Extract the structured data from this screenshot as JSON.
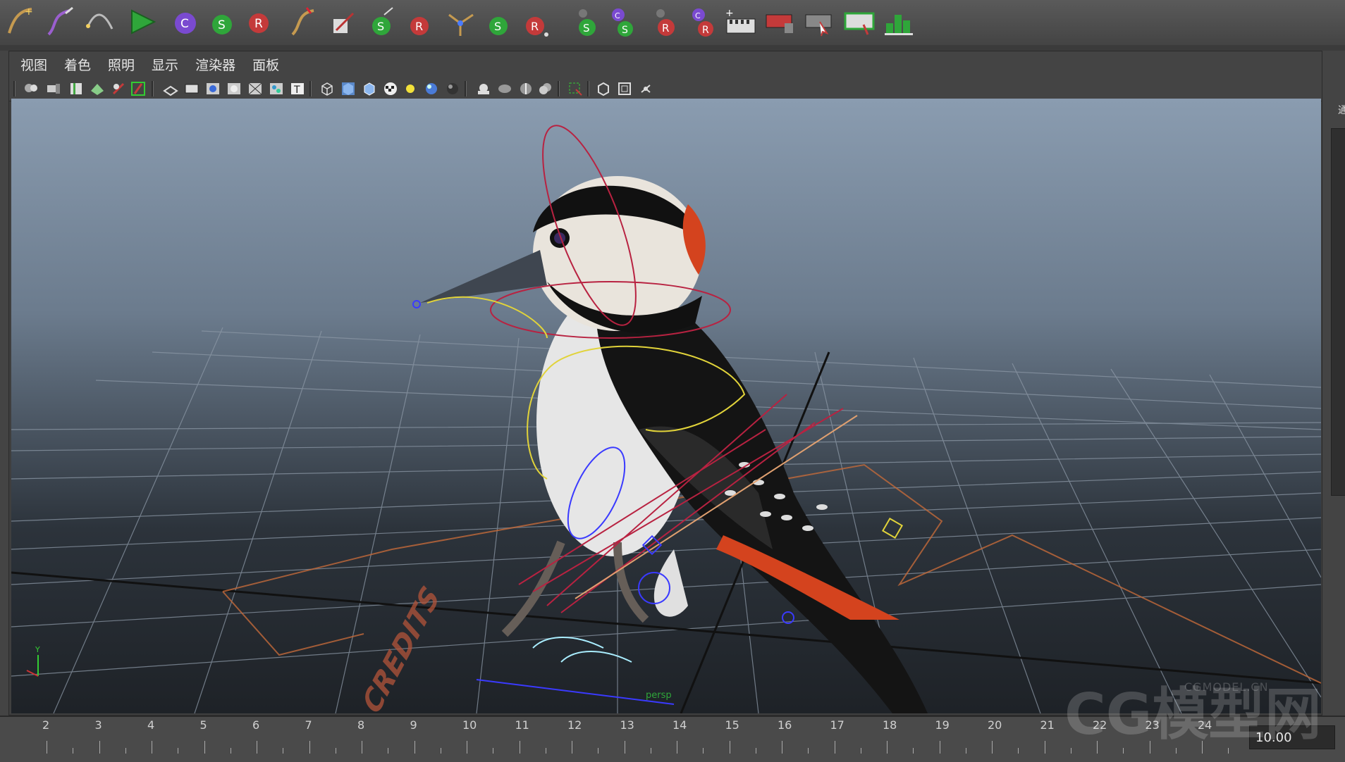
{
  "panel_menu": {
    "items": [
      "视图",
      "着色",
      "照明",
      "显示",
      "渲染器",
      "面板"
    ]
  },
  "shelf_icons": [
    "curve-tool-icon",
    "paint-curve-icon",
    "arc-curve-icon",
    "play-green-icon",
    "constraint-c-icon",
    "select-s-icon",
    "rotate-r-icon",
    "curve-brush-icon",
    "paint-on-icon",
    "set-s-icon",
    "reset-r-icon",
    "joint-tool-icon",
    "snap-s-icon",
    "rotate-r2-icon",
    "s-button-icon",
    "cs-button-icon",
    "r-button-icon",
    "cr-button-icon",
    "filmstrip-add-icon",
    "filmstrip-delete-icon",
    "filmstrip-select-icon",
    "filmstrip-edit-icon",
    "graph-icon"
  ],
  "viewport": {
    "axis_y_label": "Y",
    "credits_label": "CREDITS",
    "persp_label": "persp"
  },
  "timeline": {
    "ticks": [
      "2",
      "3",
      "4",
      "5",
      "6",
      "7",
      "8",
      "9",
      "10",
      "11",
      "12",
      "13",
      "14",
      "15",
      "16",
      "17",
      "18",
      "19",
      "20",
      "21",
      "22",
      "23",
      "24"
    ],
    "current_time": "10.00"
  },
  "watermark": {
    "main": "CG模型网",
    "small": "CGMODEL.CN"
  },
  "right_dock_label": "通",
  "colors": {
    "bg": "#444444",
    "accent_green": "#2fa63a",
    "accent_red": "#c43a3a",
    "accent_purple": "#7a4ad0"
  }
}
